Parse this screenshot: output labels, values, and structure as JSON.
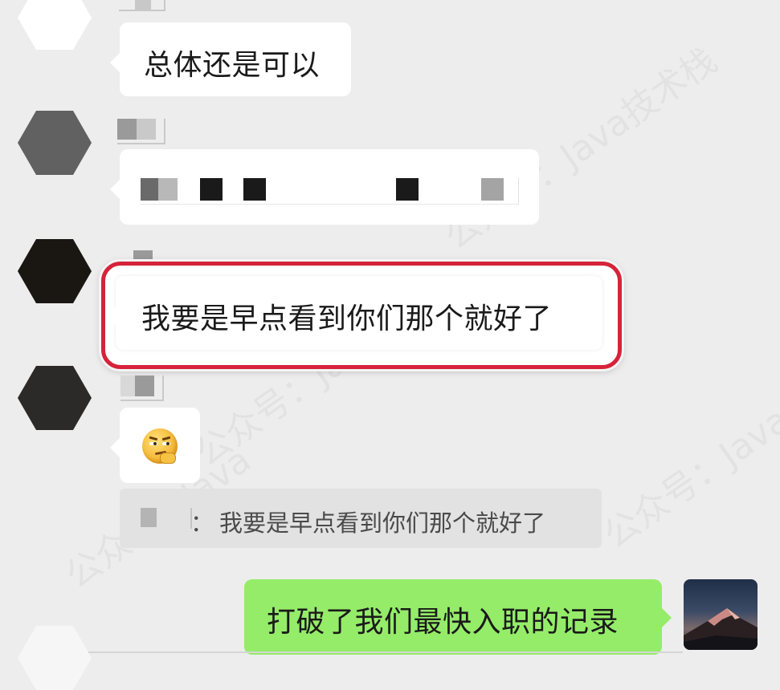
{
  "watermark": {
    "text_a": "公众号：Java技术栈",
    "text_b": "公众号：Java"
  },
  "messages": [
    {
      "text": "总体还是可以"
    },
    {
      "text": ""
    },
    {
      "text": "我要是早点看到你们那个就好了"
    },
    {
      "text": "",
      "emoji": "smirk-thinking-emoji"
    }
  ],
  "quote": {
    "separator": "：",
    "text": "我要是早点看到你们那个就好了"
  },
  "sent": {
    "text": "打破了我们最快入职的记录"
  },
  "colors": {
    "background": "#ededed",
    "bubble": "#ffffff",
    "sent_bubble": "#95ec69",
    "highlight": "#d6233a",
    "quote_bg": "#e2e2e2"
  },
  "icons": {
    "avatar_top": "hexagon-avatar-white",
    "avatar_gray": "hexagon-avatar-gray",
    "avatar_black": "hexagon-avatar-black",
    "avatar_dark": "hexagon-avatar-dark",
    "self_avatar": "mountain-avatar"
  }
}
